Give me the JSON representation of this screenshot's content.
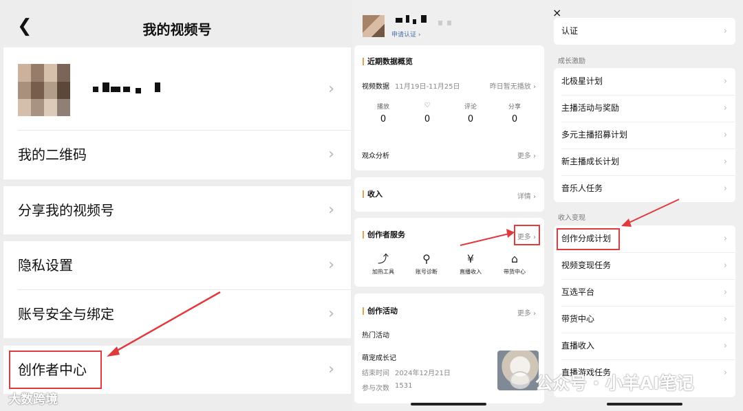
{
  "panel1": {
    "title": "我的视频号",
    "back_icon": "chevron-left-icon",
    "rows": [
      {
        "label": "我的二维码"
      },
      {
        "label": "分享我的视频号"
      },
      {
        "label": "隐私设置"
      },
      {
        "label": "账号安全与绑定"
      },
      {
        "label": "创作者中心"
      }
    ],
    "chevron": "›",
    "watermark": "大数跨境"
  },
  "panel2": {
    "apply_verify": "申请认证 ›",
    "overview_title": "近期数据概览",
    "video_data_label": "视频数据",
    "date_range": "11月19日-11月25日",
    "no_play_yesterday": "昨日暂无播放 ›",
    "stats": [
      {
        "label": "播放",
        "value": "0"
      },
      {
        "label": "♡",
        "value": "0"
      },
      {
        "label": "评论",
        "value": "0"
      },
      {
        "label": "分享",
        "value": "0"
      }
    ],
    "audience_label": "观众分析",
    "more": "更多 ›",
    "income_title": "收入",
    "details": "详情 ›",
    "creator_service_title": "创作者服务",
    "services": [
      {
        "label": "加热工具",
        "icon": "trending-up-icon",
        "glyph": "⤴"
      },
      {
        "label": "账号诊断",
        "icon": "user-search-icon",
        "glyph": "⚲"
      },
      {
        "label": "直播收入",
        "icon": "yuan-icon",
        "glyph": "¥"
      },
      {
        "label": "带货中心",
        "icon": "shop-icon",
        "glyph": "⌂"
      }
    ],
    "activity_title": "创作活动",
    "hot_activity": "热门活动",
    "activity_name": "萌宠成长记",
    "end_time_label": "结束时间",
    "end_time_value": "2024年12月21日",
    "participants_label": "参与次数",
    "participants_value": "1531"
  },
  "panel3": {
    "close_icon": "×",
    "top_row": "认证",
    "group1_title": "成长激励",
    "group1_rows": [
      "北极星计划",
      "主播活动与奖励",
      "多元主播招募计划",
      "新主播成长计划",
      "音乐人任务"
    ],
    "group2_title": "收入变现",
    "group2_rows": [
      "创作分成计划",
      "视频变现任务",
      "互选平台",
      "带货中心",
      "直播收入",
      "直播游戏任务"
    ],
    "watermark": "公众号 · 小羊AI笔记"
  },
  "colors": {
    "accent_red": "#e0393e",
    "section_bar": "#e0a34a",
    "link_blue": "#4a6fa5"
  }
}
